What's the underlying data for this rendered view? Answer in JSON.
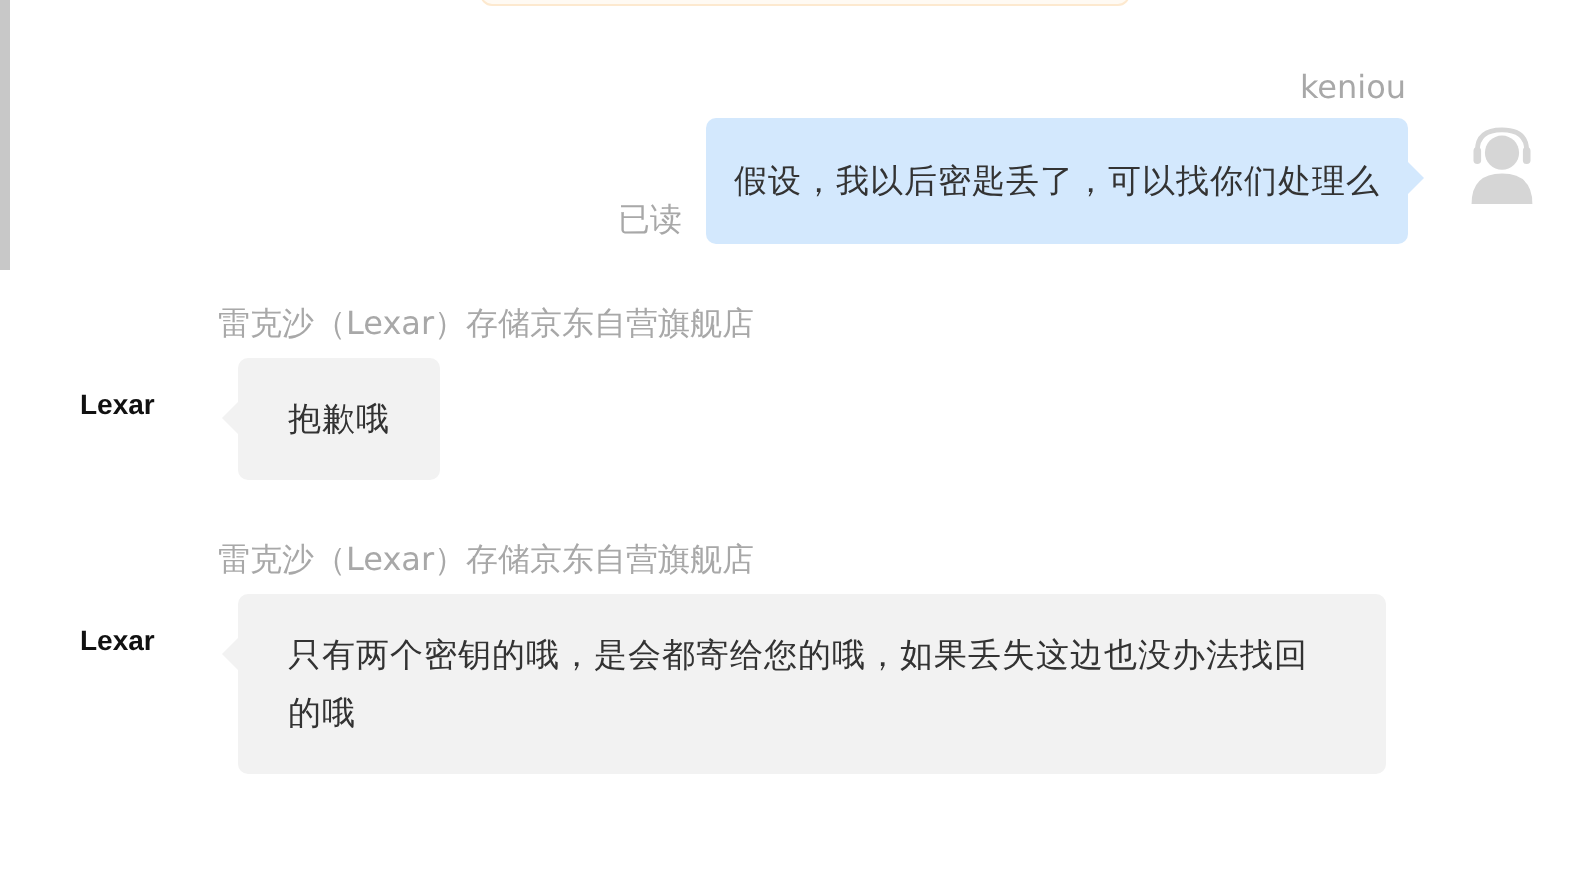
{
  "messages": [
    {
      "kind": "outgoing",
      "sender": "keniou",
      "text": "假设，我以后密匙丢了，可以找你们处理么",
      "receipt": "已读"
    },
    {
      "kind": "incoming",
      "sender": "雷克沙（Lexar）存储京东自营旗舰店",
      "avatar_text": "Lexar",
      "text": "抱歉哦"
    },
    {
      "kind": "incoming",
      "sender": "雷克沙（Lexar）存储京东自营旗舰店",
      "avatar_text": "Lexar",
      "text": "只有两个密钥的哦，是会都寄给您的哦，如果丢失这边也没办法找回的哦"
    }
  ]
}
